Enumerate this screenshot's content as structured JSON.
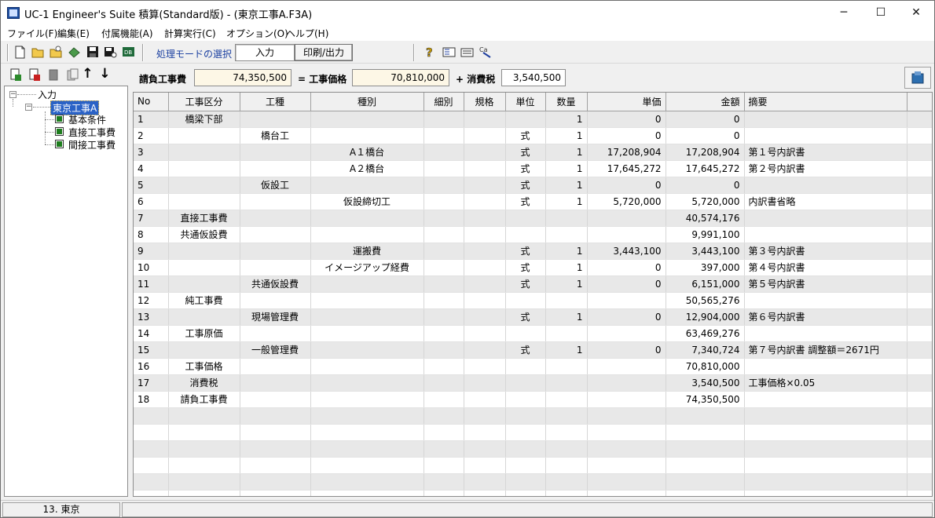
{
  "window": {
    "title": "UC-1 Engineer's Suite 積算(Standard版) - (東京工事A.F3A)",
    "controls": {
      "minimize": "─",
      "maximize": "☐",
      "close": "✕"
    }
  },
  "menu": [
    "ファイル(F)",
    "編集(E)",
    "付属機能(A)",
    "計算実行(C)",
    "オプション(O)",
    "ヘルプ(H)"
  ],
  "toolbar": {
    "mode_label": "処理モードの選択",
    "mode_input": "入力",
    "mode_print": "印刷/出力",
    "icons": [
      "new-file-icon",
      "open-folder-icon",
      "open-recent-icon",
      "import-icon",
      "save-icon",
      "save-as-icon",
      "database-icon",
      "help-icon",
      "info-icon",
      "keyboard-icon",
      "settings-icon"
    ]
  },
  "left_tools": {
    "up": "↑",
    "down": "↓"
  },
  "tree": {
    "root": "入力",
    "project": "東京工事A",
    "children": [
      "基本条件",
      "直接工事費",
      "間接工事費"
    ]
  },
  "summary": {
    "contract_label": "請負工事費",
    "contract_value": "74,350,500",
    "eq": "= 工事価格",
    "price_value": "70,810,000",
    "plus": "+ 消費税",
    "tax_value": "3,540,500"
  },
  "grid": {
    "columns": [
      "No",
      "工事区分",
      "工種",
      "種別",
      "細別",
      "規格",
      "単位",
      "数量",
      "単価",
      "金額",
      "摘要"
    ],
    "rows": [
      [
        "1",
        "橋梁下部",
        "",
        "",
        "",
        "",
        "",
        "1",
        "0",
        "0",
        ""
      ],
      [
        "2",
        "",
        "橋台工",
        "",
        "",
        "",
        "式",
        "1",
        "0",
        "0",
        ""
      ],
      [
        "3",
        "",
        "",
        "A１橋台",
        "",
        "",
        "式",
        "1",
        "17,208,904",
        "17,208,904",
        "第１号内訳書"
      ],
      [
        "4",
        "",
        "",
        "A２橋台",
        "",
        "",
        "式",
        "1",
        "17,645,272",
        "17,645,272",
        "第２号内訳書"
      ],
      [
        "5",
        "",
        "仮設工",
        "",
        "",
        "",
        "式",
        "1",
        "0",
        "0",
        ""
      ],
      [
        "6",
        "",
        "",
        "仮設締切工",
        "",
        "",
        "式",
        "1",
        "5,720,000",
        "5,720,000",
        "内訳書省略"
      ],
      [
        "7",
        "直接工事費",
        "",
        "",
        "",
        "",
        "",
        "",
        "",
        "40,574,176",
        ""
      ],
      [
        "8",
        "共通仮設費",
        "",
        "",
        "",
        "",
        "",
        "",
        "",
        "9,991,100",
        ""
      ],
      [
        "9",
        "",
        "",
        "運搬費",
        "",
        "",
        "式",
        "1",
        "3,443,100",
        "3,443,100",
        "第３号内訳書"
      ],
      [
        "10",
        "",
        "",
        "イメージアップ経費",
        "",
        "",
        "式",
        "1",
        "0",
        "397,000",
        "第４号内訳書"
      ],
      [
        "11",
        "",
        "共通仮設費",
        "",
        "",
        "",
        "式",
        "1",
        "0",
        "6,151,000",
        "第５号内訳書"
      ],
      [
        "12",
        "純工事費",
        "",
        "",
        "",
        "",
        "",
        "",
        "",
        "50,565,276",
        ""
      ],
      [
        "13",
        "",
        "現場管理費",
        "",
        "",
        "",
        "式",
        "1",
        "0",
        "12,904,000",
        "第６号内訳書"
      ],
      [
        "14",
        "工事原価",
        "",
        "",
        "",
        "",
        "",
        "",
        "",
        "63,469,276",
        ""
      ],
      [
        "15",
        "",
        "一般管理費",
        "",
        "",
        "",
        "式",
        "1",
        "0",
        "7,340,724",
        "第７号内訳書 調整額＝2671円"
      ],
      [
        "16",
        "工事価格",
        "",
        "",
        "",
        "",
        "",
        "",
        "",
        "70,810,000",
        ""
      ],
      [
        "17",
        "消費税",
        "",
        "",
        "",
        "",
        "",
        "",
        "",
        "3,540,500",
        "工事価格×0.05"
      ],
      [
        "18",
        "請負工事費",
        "",
        "",
        "",
        "",
        "",
        "",
        "",
        "74,350,500",
        ""
      ],
      [
        "",
        "",
        "",
        "",
        "",
        "",
        "",
        "",
        "",
        "",
        ""
      ],
      [
        "",
        "",
        "",
        "",
        "",
        "",
        "",
        "",
        "",
        "",
        ""
      ],
      [
        "",
        "",
        "",
        "",
        "",
        "",
        "",
        "",
        "",
        "",
        ""
      ],
      [
        "",
        "",
        "",
        "",
        "",
        "",
        "",
        "",
        "",
        "",
        ""
      ],
      [
        "",
        "",
        "",
        "",
        "",
        "",
        "",
        "",
        "",
        "",
        ""
      ],
      [
        "",
        "",
        "",
        "",
        "",
        "",
        "",
        "",
        "",
        "",
        ""
      ]
    ]
  },
  "status": {
    "location": "13. 東京"
  }
}
